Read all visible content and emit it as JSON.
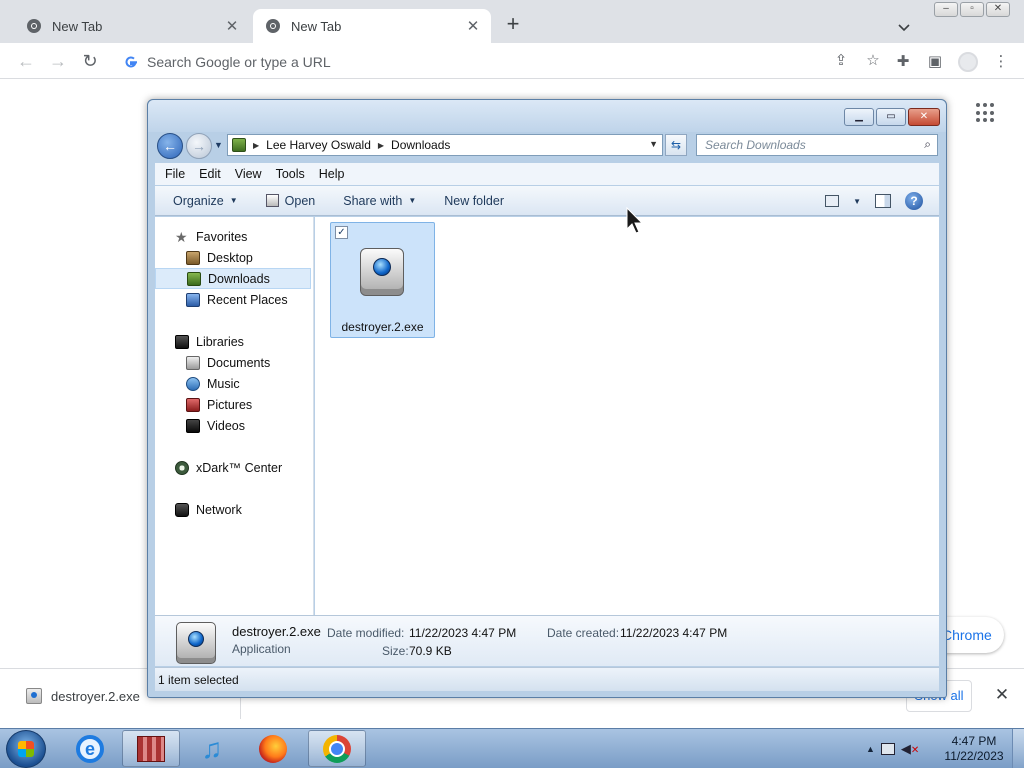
{
  "browser": {
    "tabs": [
      {
        "label": "New Tab",
        "icon": "chrome-icon"
      },
      {
        "label": "New Tab",
        "icon": "chrome-icon"
      }
    ],
    "new_tab_symbol": "+",
    "close_symbol": "✕",
    "omnibox_placeholder": "Search Google or type a URL",
    "customize_label": "Chrome"
  },
  "download_shelf": {
    "file_name": "destroyer.2.exe",
    "show_all_label": "Show all",
    "close_symbol": "✕"
  },
  "explorer": {
    "breadcrumb": [
      "Lee Harvey Oswald",
      "Downloads"
    ],
    "search_placeholder": "Search Downloads",
    "menu": [
      "File",
      "Edit",
      "View",
      "Tools",
      "Help"
    ],
    "commands": {
      "organize": "Organize",
      "open": "Open",
      "share_with": "Share with",
      "new_folder": "New folder"
    },
    "nav": {
      "favorites": {
        "label": "Favorites",
        "items": [
          "Desktop",
          "Downloads",
          "Recent Places"
        ]
      },
      "libraries": {
        "label": "Libraries",
        "items": [
          "Documents",
          "Music",
          "Pictures",
          "Videos"
        ]
      },
      "xdark": "xDark™ Center",
      "network": "Network"
    },
    "selected_nav": "Downloads",
    "files": [
      {
        "name": "destroyer.2.exe",
        "selected": true,
        "checked": true
      }
    ],
    "details": {
      "name": "destroyer.2.exe",
      "type": "Application",
      "date_modified_label": "Date modified:",
      "date_modified": "11/22/2023 4:47 PM",
      "date_created_label": "Date created:",
      "date_created": "11/22/2023 4:47 PM",
      "size_label": "Size:",
      "size": "70.9 KB"
    },
    "status": "1 item selected"
  },
  "taskbar": {
    "apps": [
      "internet-explorer",
      "archive-manager",
      "music-player",
      "firefox",
      "chrome"
    ],
    "active_app": "chrome",
    "time": "4:47 PM",
    "date": "11/22/2023"
  },
  "colors": {
    "chrome_tabstrip": "#dee1e6",
    "explorer_frame": "#b8cfe6",
    "selection": "#cce3fa",
    "link_blue": "#1a73e8"
  }
}
